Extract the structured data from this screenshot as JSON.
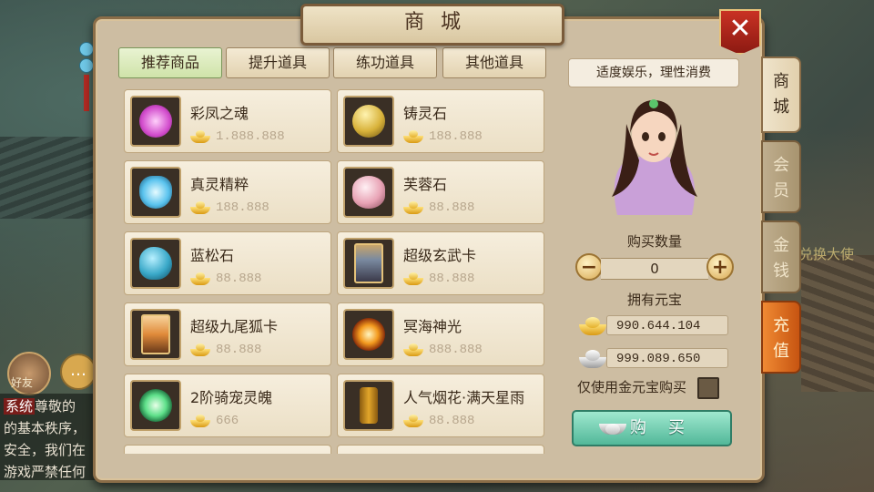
{
  "title": "商城",
  "background": {
    "chat_lines": [
      "尊敬的",
      "的基本秩序，",
      "安全，我们在",
      "游戏严禁任何"
    ],
    "friend_label": "好友",
    "right_text": "兑换大使"
  },
  "tabs": [
    {
      "label": "推荐商品",
      "active": true
    },
    {
      "label": "提升道具",
      "active": false
    },
    {
      "label": "练功道具",
      "active": false
    },
    {
      "label": "其他道具",
      "active": false
    }
  ],
  "products": [
    {
      "name": "彩凤之魂",
      "price": "1.888.888",
      "icon": "pink-orb-icon",
      "color": "#e06ad8"
    },
    {
      "name": "铸灵石",
      "price": "188.888",
      "icon": "gold-stone-icon",
      "color": "#d8b23a"
    },
    {
      "name": "真灵精粹",
      "price": "188.888",
      "icon": "blue-vase-icon",
      "color": "#5ac3ee"
    },
    {
      "name": "芙蓉石",
      "price": "88.888",
      "icon": "pink-stone-icon",
      "color": "#e8a3b5"
    },
    {
      "name": "蓝松石",
      "price": "88.888",
      "icon": "turquoise-icon",
      "color": "#3aa9c9"
    },
    {
      "name": "超级玄武卡",
      "price": "88.888",
      "icon": "xuanwu-card-icon",
      "color": "#7a8aa0"
    },
    {
      "name": "超级九尾狐卡",
      "price": "88.888",
      "icon": "fox-card-icon",
      "color": "#e08a3a"
    },
    {
      "name": "冥海神光",
      "price": "888.888",
      "icon": "sunburst-icon",
      "color": "#f39a1e"
    },
    {
      "name": "2阶骑宠灵魄",
      "price": "666",
      "icon": "green-orb-icon",
      "color": "#5ee08a"
    },
    {
      "name": "人气烟花·满天星雨",
      "price": "88.888",
      "icon": "firework-icon",
      "color": "#e2a62a"
    }
  ],
  "side": {
    "slogan": "适度娱乐，理性消费",
    "qty_label": "购买数量",
    "qty_value": "0",
    "minus": "−",
    "plus": "+",
    "owned_label": "拥有元宝",
    "gold_amount": "990.644.104",
    "silver_amount": "999.089.650",
    "only_gold_label": "仅使用金元宝购买",
    "buy_label": "购买"
  },
  "side_tabs": [
    {
      "label": "商城",
      "state": "active"
    },
    {
      "label": "会员",
      "state": "normal"
    },
    {
      "label": "金钱",
      "state": "normal"
    },
    {
      "label": "充值",
      "state": "recharge"
    }
  ],
  "close_label": "✕"
}
